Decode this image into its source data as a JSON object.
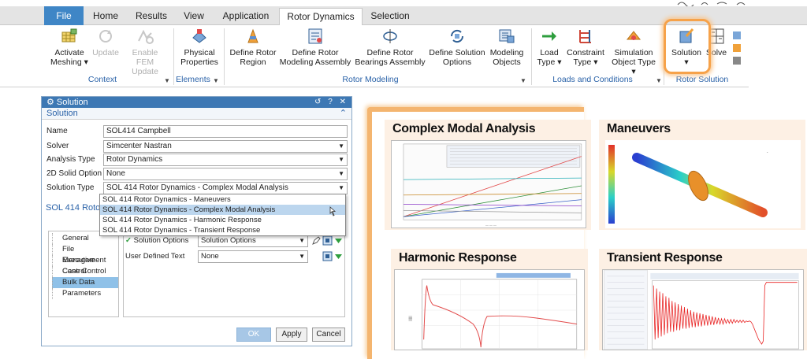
{
  "ribbon": {
    "tabs": [
      {
        "label": "File"
      },
      {
        "label": "Home"
      },
      {
        "label": "Results"
      },
      {
        "label": "View"
      },
      {
        "label": "Application"
      },
      {
        "label": "Rotor Dynamics"
      },
      {
        "label": "Selection"
      }
    ],
    "buttons": {
      "activate_meshing": [
        "Activate",
        "Meshing ▾"
      ],
      "update": [
        "Update",
        ""
      ],
      "enable_fem_update": [
        "Enable FEM",
        "Update"
      ],
      "physical_properties": [
        "Physical",
        "Properties"
      ],
      "define_rotor_region": [
        "Define Rotor",
        "Region"
      ],
      "define_rotor_modeling_assembly": [
        "Define Rotor",
        "Modeling Assembly"
      ],
      "define_rotor_bearings_assembly": [
        "Define Rotor",
        "Bearings Assembly"
      ],
      "define_solution_options": [
        "Define Solution",
        "Options"
      ],
      "modeling_objects": [
        "Modeling",
        "Objects"
      ],
      "load_type": [
        "Load",
        "Type ▾"
      ],
      "constraint_type": [
        "Constraint",
        "Type ▾"
      ],
      "simulation_object_type": [
        "Simulation",
        "Object Type ▾"
      ],
      "solution": [
        "Solution",
        "▾"
      ],
      "solve": [
        "Solve",
        ""
      ]
    },
    "groups": {
      "context": "Context",
      "elements": "Elements",
      "rotor_modeling": "Rotor Modeling",
      "loads_and_conditions": "Loads and Conditions",
      "rotor_solution": "Rotor Solution"
    }
  },
  "dialog": {
    "title": "Solution",
    "title_controls": "↺ ? ✕",
    "section": "Solution",
    "fields": {
      "name_label": "Name",
      "name_value": "SOL414 Campbell",
      "solver_label": "Solver",
      "solver_value": "Simcenter Nastran",
      "analysis_type_label": "Analysis Type",
      "analysis_type_value": "Rotor Dynamics",
      "solid_option_label": "2D Solid Option",
      "solid_option_value": "None",
      "solution_type_label": "Solution Type",
      "solution_type_value": "SOL 414 Rotor Dynamics - Complex Modal Analysis"
    },
    "solution_type_options": [
      "SOL 414 Rotor Dynamics - Maneuvers",
      "SOL 414 Rotor Dynamics - Complex Modal Analysis",
      "SOL 414 Rotor Dynamics - Harmonic Response",
      "SOL 414 Rotor Dynamics - Transient Response"
    ],
    "sol414_section": "SOL 414 Rotor",
    "tree_items": [
      "General",
      "File Management",
      "Executive Control",
      "Case Control",
      "Bulk Data",
      "Parameters"
    ],
    "props": {
      "solution_options_label": "Solution Options",
      "solution_options_value": "Solution Options",
      "user_defined_text_label": "User Defined Text",
      "user_defined_text_value": "None"
    },
    "buttons": {
      "ok": "OK",
      "apply": "Apply",
      "cancel": "Cancel"
    }
  },
  "results": {
    "complex_modal": "Complex Modal Analysis",
    "maneuvers": "Maneuvers",
    "harmonic": "Harmonic Response",
    "transient": "Transient Response"
  },
  "colors": {
    "file_tab": "#3f86c6",
    "accent_blue": "#2a62a8",
    "highlight_orange": "#f6a24a",
    "card_bg": "#fdf0e4"
  }
}
